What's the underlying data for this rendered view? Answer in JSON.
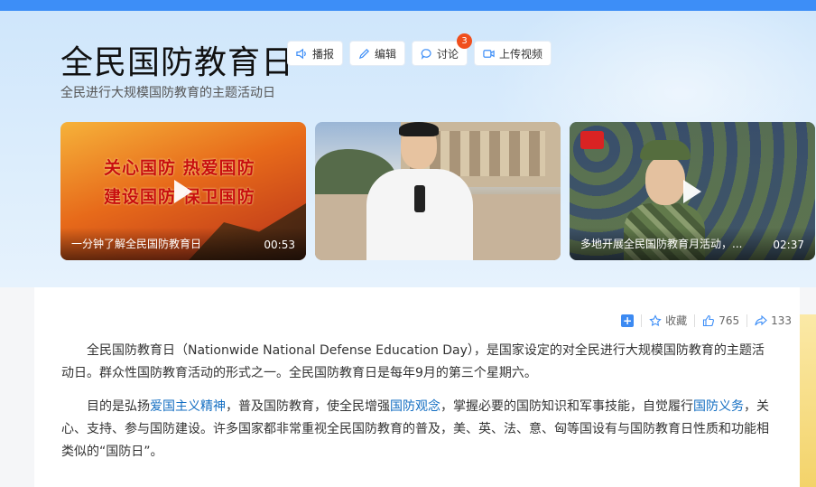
{
  "header": {
    "title": "全民国防教育日",
    "subtitle": "全民进行大规模国防教育的主题活动日",
    "actions": [
      {
        "label": "播报",
        "icon": "speaker-icon"
      },
      {
        "label": "编辑",
        "icon": "pencil-icon"
      },
      {
        "label": "讨论",
        "icon": "chat-icon",
        "badge": "3"
      },
      {
        "label": "上传视频",
        "icon": "video-upload-icon"
      }
    ]
  },
  "videos": [
    {
      "title": "一分钟了解全民国防教育日",
      "duration": "00:53",
      "slogan_line1": "关心国防 热爱国防",
      "slogan_line2": "建设国防 保卫国防"
    },
    {
      "title": "",
      "duration": ""
    },
    {
      "title": "多地开展全民国防教育月活动，...",
      "duration": "02:37"
    }
  ],
  "toolbar": {
    "collect_label": "收藏",
    "like_count": "765",
    "share_count": "133"
  },
  "article": {
    "p1": "全民国防教育日（Nationwide National Defense Education Day），是国家设定的对全民进行大规模国防教育的主题活动日。群众性国防教育活动的形式之一。全民国防教育日是每年9月的第三个星期六。",
    "p2_a": "目的是弘扬",
    "p2_link1": "爱国主义精神",
    "p2_b": "，普及国防教育，使全民增强",
    "p2_link2": "国防观念",
    "p2_c": "，掌握必要的国防知识和军事技能，自觉履行",
    "p2_link3": "国防义务",
    "p2_d": "，关心、支持、参与国防建设。许多国家都非常重视全民国防教育的普及，美、英、法、意、匈等国设有与国防教育日性质和功能相类似的“国防日”。"
  },
  "colors": {
    "accent": "#3d8ef7",
    "link": "#136ec2",
    "badge": "#f04e1c"
  }
}
